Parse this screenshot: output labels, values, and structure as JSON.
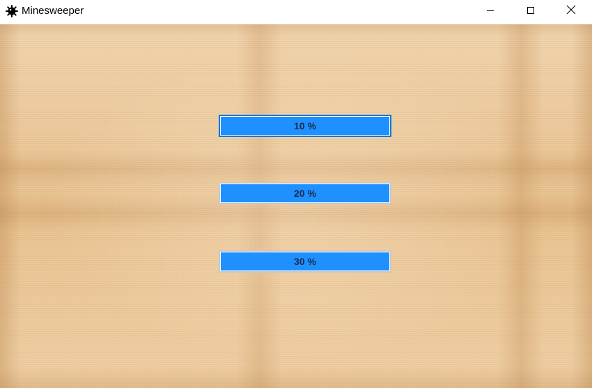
{
  "window": {
    "title": "Minesweeper",
    "icon": "mine-icon",
    "controls": {
      "minimize": "minimize-icon",
      "maximize": "maximize-icon",
      "close": "close-icon"
    }
  },
  "main": {
    "buttons": [
      {
        "label": "10 %"
      },
      {
        "label": "20 %"
      },
      {
        "label": "30 %"
      }
    ]
  },
  "colors": {
    "button_fill": "#1e90ff",
    "button_text": "#1b2a4a",
    "focus_border": "#0078d7",
    "background": "#ecc99b"
  }
}
